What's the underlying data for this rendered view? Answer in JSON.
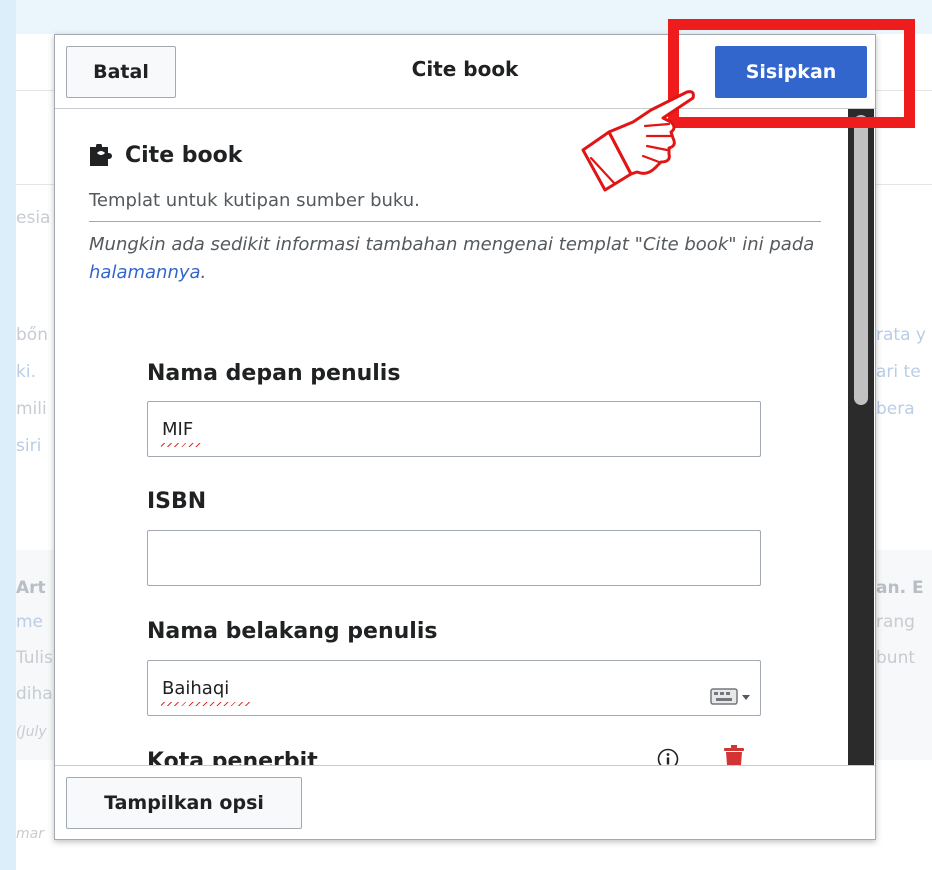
{
  "dialog": {
    "title": "Cite book",
    "cancel_label": "Batal",
    "insert_label": "Sisipkan",
    "show_options_label": "Tampilkan opsi"
  },
  "template": {
    "name": "Cite book",
    "description": "Templat untuk kutipan sumber buku.",
    "note_prefix": "Mungkin ada sedikit informasi tambahan mengenai templat \"Cite book\" ini pada ",
    "note_link": "halamannya",
    "note_suffix": "."
  },
  "params": [
    {
      "label": "Nama depan penulis",
      "value": ""
    },
    {
      "label": "ISBN",
      "value": ""
    },
    {
      "label": "Nama belakang penulis",
      "value": ""
    },
    {
      "label": "Kota penerbit",
      "value": ""
    }
  ],
  "param_values": {
    "first_name": "MIF",
    "isbn": "",
    "last_name": "Baihaqi",
    "city": ""
  },
  "background": {
    "frag1": "esia",
    "frag2": "bőn",
    "frag3": "ki.",
    "frag4": "mili",
    "frag5": "siri",
    "frag6": "rata y",
    "frag7": "ari te",
    "frag8": "bera",
    "frag9": "Art",
    "frag10": "me",
    "frag11": "Tulis",
    "frag12": "diha",
    "frag13": "(July",
    "frag14": "an. E",
    "frag15": "rang",
    "frag16": "bunt",
    "frag17": "mar"
  },
  "colors": {
    "accent": "#3366cc",
    "annotation": "#ee1c1c",
    "destructive": "#d33333"
  },
  "icons": {
    "template": "puzzle-icon",
    "keyboard": "keyboard-icon",
    "info": "info-icon",
    "remove": "trash-icon",
    "pointer": "pointing-hand-icon"
  }
}
